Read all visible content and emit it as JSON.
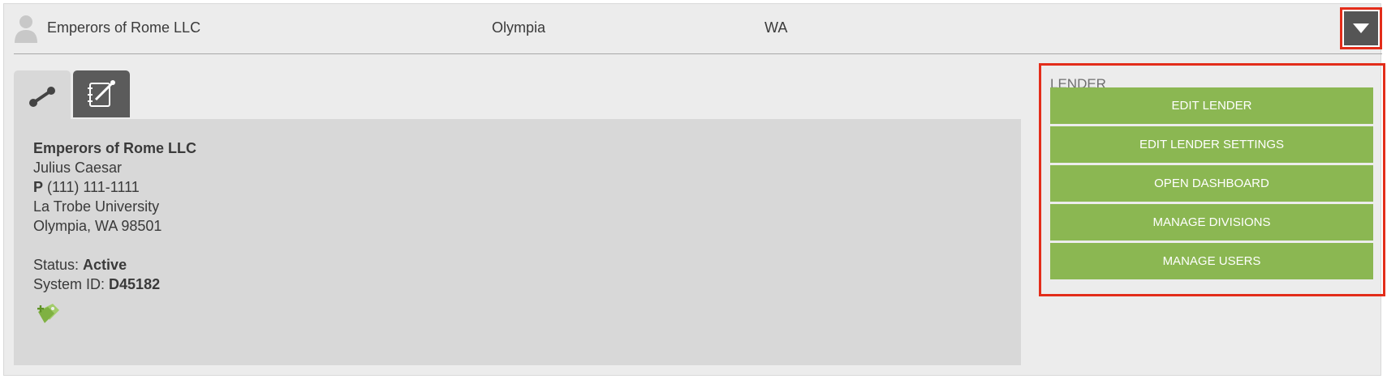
{
  "header": {
    "name": "Emperors of Rome LLC",
    "city": "Olympia",
    "state": "WA",
    "toggle_icon": "caret-down-icon"
  },
  "tabs": [
    {
      "icon": "link-icon",
      "active": true
    },
    {
      "icon": "notes-icon",
      "active": false
    }
  ],
  "details": {
    "company": "Emperors of Rome LLC",
    "contact": "Julius Caesar",
    "phone_label": "P",
    "phone": "(111) 111-1111",
    "address1": "La Trobe University",
    "address2": "Olympia, WA 98501",
    "status_label": "Status:",
    "status": "Active",
    "system_id_label": "System ID:",
    "system_id": "D45182",
    "badge_icon": "tags-add-icon"
  },
  "lender": {
    "title": "LENDER",
    "buttons": [
      "EDIT LENDER",
      "EDIT LENDER SETTINGS",
      "OPEN DASHBOARD",
      "MANAGE DIVISIONS",
      "MANAGE USERS"
    ]
  },
  "colors": {
    "accent_green": "#8bb752",
    "highlight_red": "#e32d1a",
    "dark_gray": "#555555"
  }
}
